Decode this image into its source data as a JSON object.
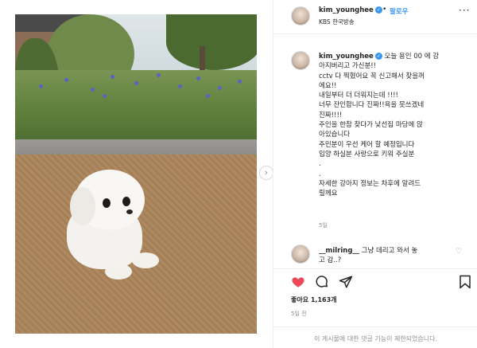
{
  "header": {
    "username": "kim_younghee",
    "separator": "•",
    "follow_label": "팔로우",
    "subtitle": "KBS 한국방송",
    "more_label": "···"
  },
  "caption": {
    "username": "kim_younghee",
    "lines": [
      "오늘 용인 00 에 강",
      "아지버리고 가신분!!",
      "cctv 다 찍혔어요 꼭 신고해서 찾을꺼",
      "에요!!",
      "내일부터 더 더워지는데 !!!!",
      "너무 잔인합니다 진짜!!욕을 못쓰겠네",
      "진짜!!!!",
      "주인을 한참 찾다가 낯선집 마당에 앉",
      "아있습니다",
      "주민분이 우선 케어 할 예정입니다",
      "입양 하실분 사랑으로 키워 주실분",
      ".",
      ".",
      "자세한 강아지 정보는 차후에 알려드",
      "릴께요"
    ],
    "time": "5일"
  },
  "comment": {
    "username": "__milring__",
    "line1": "그냥 데리고 와서 놓",
    "line2": "고 감..?"
  },
  "actions": {
    "likes": "좋아요 1,163개",
    "time_ago": "5일 전",
    "comments_disabled": "이 게시물에 대한 댓글 기능이 제한되었습니다."
  },
  "colors": {
    "like_red": "#ed4956",
    "link_blue": "#3897f0",
    "muted_gray": "#8e8e8e"
  },
  "icons": {
    "verified": "verified-badge-icon",
    "next": "chevron-right-icon",
    "heart": "heart-filled-icon",
    "comment": "comment-bubble-icon",
    "share": "paper-plane-icon",
    "save": "bookmark-icon",
    "comment_like": "heart-outline-icon"
  }
}
